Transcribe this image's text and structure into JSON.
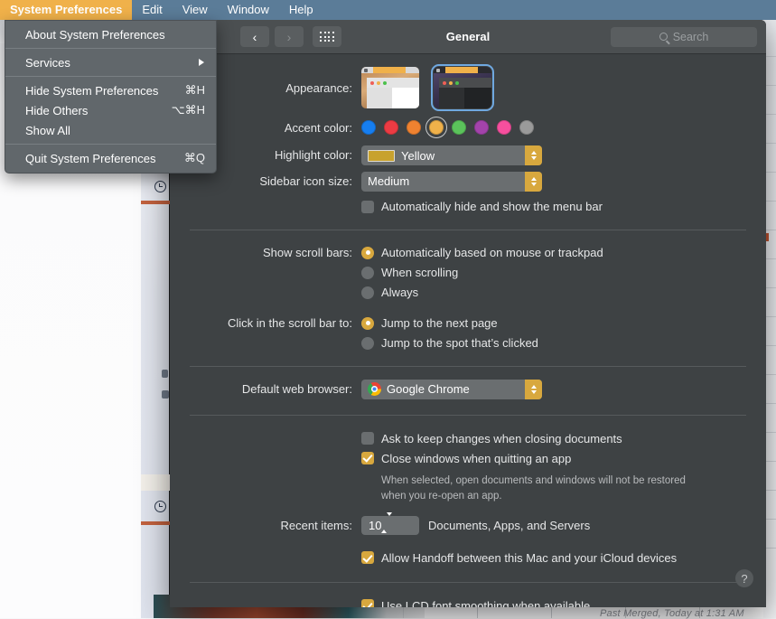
{
  "menubar": {
    "items": [
      {
        "label": "System Preferences",
        "active": true
      },
      {
        "label": "Edit",
        "active": false
      },
      {
        "label": "View",
        "active": false
      },
      {
        "label": "Window",
        "active": false
      },
      {
        "label": "Help",
        "active": false
      }
    ]
  },
  "app_menu": {
    "items": [
      {
        "label": "About System Preferences",
        "shortcut": "",
        "submenu": false
      },
      {
        "label": "Services",
        "shortcut": "",
        "submenu": true
      },
      {
        "label": "Hide System Preferences",
        "shortcut": "⌘H",
        "submenu": false
      },
      {
        "label": "Hide Others",
        "shortcut": "⌥⌘H",
        "submenu": false
      },
      {
        "label": "Show All",
        "shortcut": "",
        "submenu": false
      },
      {
        "label": "Quit System Preferences",
        "shortcut": "⌘Q",
        "submenu": false
      }
    ]
  },
  "window": {
    "title": "General",
    "back_icon": "chevron-left-icon",
    "forward_icon": "chevron-right-icon",
    "grid_icon": "show-all-grid-icon",
    "search": {
      "placeholder": "Search",
      "value": "",
      "icon": "search-icon"
    },
    "help_label": "?"
  },
  "general": {
    "appearance": {
      "label": "Appearance:",
      "options": [
        {
          "name": "Light",
          "selected": false
        },
        {
          "name": "Dark",
          "selected": true
        }
      ]
    },
    "accent_color": {
      "label": "Accent color:",
      "options": [
        {
          "name": "Blue",
          "hex": "#167ef0",
          "selected": false
        },
        {
          "name": "Red",
          "hex": "#ec3b43",
          "selected": false
        },
        {
          "name": "Orange",
          "hex": "#ef8230",
          "selected": false
        },
        {
          "name": "Yellow",
          "hex": "#f0b14a",
          "selected": true
        },
        {
          "name": "Green",
          "hex": "#5bc35b",
          "selected": false
        },
        {
          "name": "Purple",
          "hex": "#a343ab",
          "selected": false
        },
        {
          "name": "Pink",
          "hex": "#f74f9e",
          "selected": false
        },
        {
          "name": "Graphite",
          "hex": "#9a9a9a",
          "selected": false
        }
      ]
    },
    "highlight_color": {
      "label": "Highlight color:",
      "value": "Yellow",
      "swatch_hex": "#c8a22e"
    },
    "sidebar_icon_size": {
      "label": "Sidebar icon size:",
      "value": "Medium"
    },
    "auto_hide_menu_bar": {
      "label": "Automatically hide and show the menu bar",
      "checked": false
    },
    "show_scroll_bars": {
      "label": "Show scroll bars:",
      "options": [
        {
          "label": "Automatically based on mouse or trackpad",
          "selected": true
        },
        {
          "label": "When scrolling",
          "selected": false
        },
        {
          "label": "Always",
          "selected": false
        }
      ]
    },
    "click_scroll_bar": {
      "label": "Click in the scroll bar to:",
      "options": [
        {
          "label": "Jump to the next page",
          "selected": true
        },
        {
          "label": "Jump to the spot that’s clicked",
          "selected": false
        }
      ]
    },
    "default_web_browser": {
      "label": "Default web browser:",
      "value": "Google Chrome",
      "icon": "chrome-icon"
    },
    "ask_keep_changes": {
      "label": "Ask to keep changes when closing documents",
      "checked": false
    },
    "close_windows_quitting": {
      "label": "Close windows when quitting an app",
      "checked": true,
      "note": "When selected, open documents and windows will not be restored when you re-open an app."
    },
    "recent_items": {
      "label": "Recent items:",
      "value": "10",
      "suffix": "Documents, Apps, and Servers"
    },
    "allow_handoff": {
      "label": "Allow Handoff between this Mac and your iCloud devices",
      "checked": true
    },
    "lcd_font_smoothing": {
      "label": "Use LCD font smoothing when available",
      "checked": true
    }
  },
  "background": {
    "footnote": "Past Merged, Today at 1:31 AM"
  }
}
